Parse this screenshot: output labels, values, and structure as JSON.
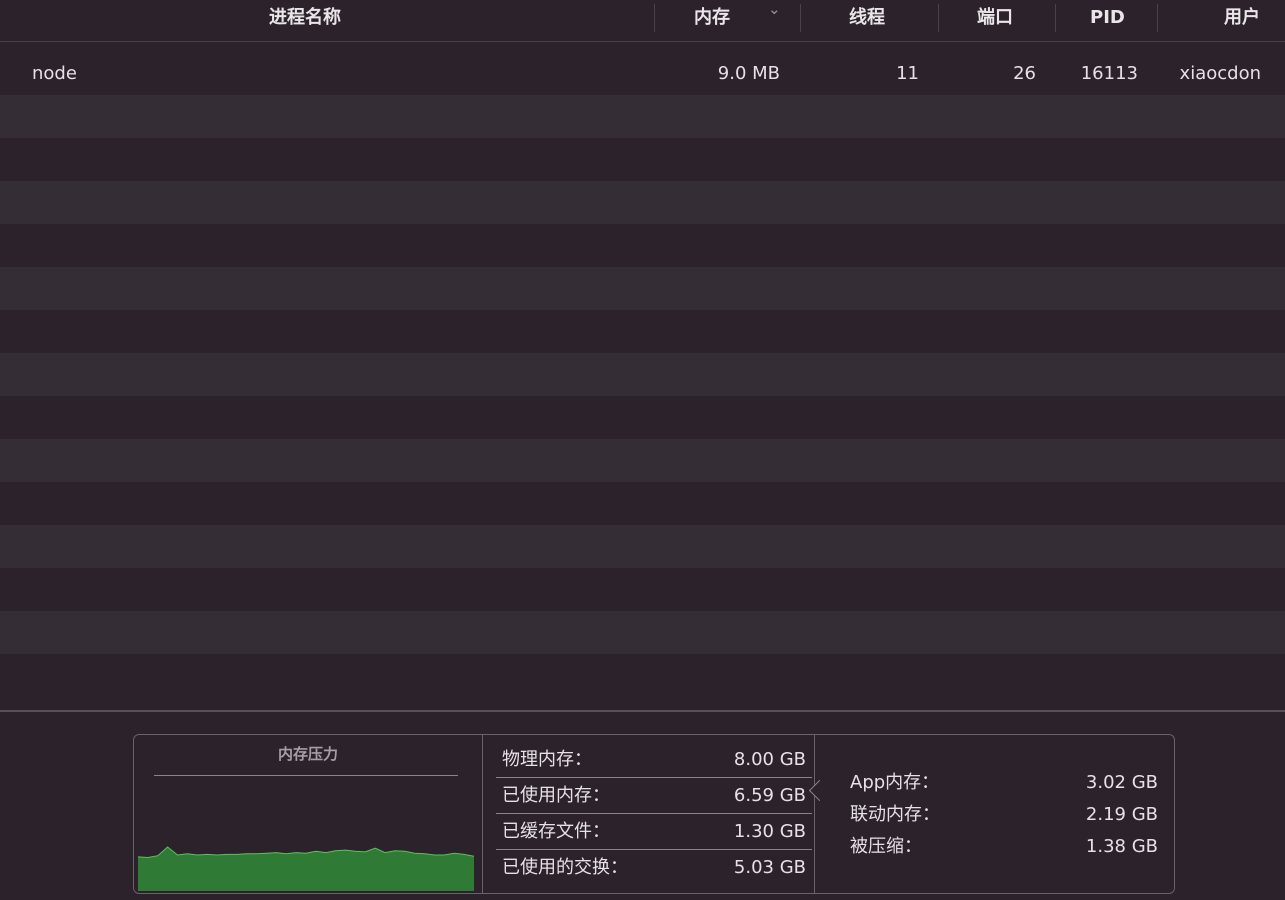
{
  "columns": {
    "process_name": "进程名称",
    "memory": "内存",
    "threads": "线程",
    "ports": "端口",
    "pid": "PID",
    "user": "用户"
  },
  "processes": [
    {
      "name": "node",
      "memory": "9.0 MB",
      "threads": "11",
      "ports": "26",
      "pid": "16113",
      "user": "xiaocdon"
    }
  ],
  "memory_pressure": {
    "title": "内存压力",
    "level_fraction_series": [
      0.55,
      0.54,
      0.57,
      0.71,
      0.58,
      0.6,
      0.58,
      0.59,
      0.58,
      0.59,
      0.59,
      0.6,
      0.6,
      0.61,
      0.62,
      0.6,
      0.62,
      0.61,
      0.64,
      0.62,
      0.65,
      0.66,
      0.64,
      0.63,
      0.69,
      0.62,
      0.65,
      0.64,
      0.61,
      0.6,
      0.58,
      0.58,
      0.61,
      0.59,
      0.56
    ],
    "color": "#2f7a34"
  },
  "stats": {
    "physical": {
      "label": "物理内存：",
      "value": "8.00 GB"
    },
    "used": {
      "label": "已使用内存：",
      "value": "6.59 GB"
    },
    "cached": {
      "label": "已缓存文件：",
      "value": "1.30 GB"
    },
    "swap": {
      "label": "已使用的交换：",
      "value": "5.03 GB"
    }
  },
  "app_breakdown": {
    "app": {
      "label": "App内存：",
      "value": "3.02 GB"
    },
    "wired": {
      "label": "联动内存：",
      "value": "2.19 GB"
    },
    "compressed": {
      "label": "被压缩：",
      "value": "1.38 GB"
    }
  }
}
